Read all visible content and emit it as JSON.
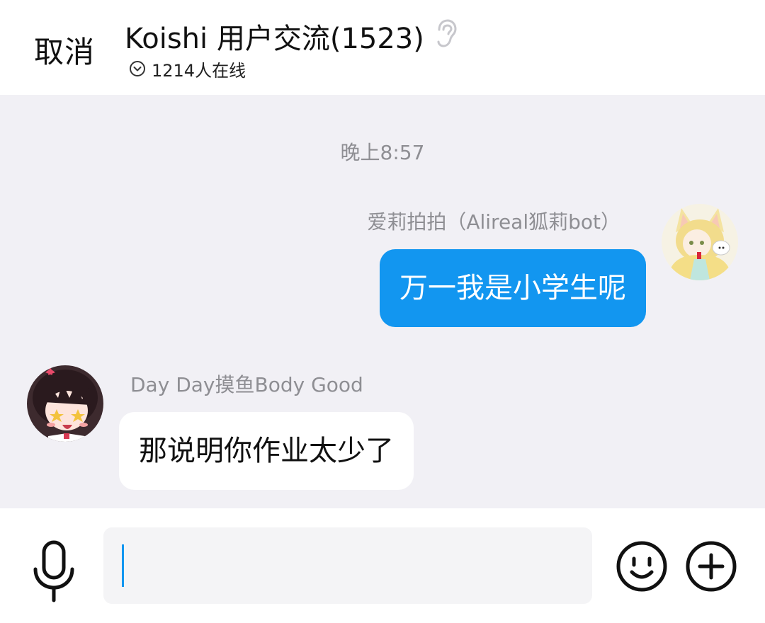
{
  "header": {
    "cancel_label": "取消",
    "group_title": "Koishi 用户交流(1523)",
    "online_count": "1214人在线"
  },
  "chat": {
    "timestamp": "晚上8:57",
    "messages": [
      {
        "side": "right",
        "sender": "爱莉拍拍（Alireal狐莉bot）",
        "text": "万一我是小学生呢",
        "bubble_color": "#1296F0"
      },
      {
        "side": "left",
        "sender": "Day Day摸鱼Body Good",
        "text": "那说明你作业太少了",
        "bubble_color": "#FFFFFF"
      }
    ]
  },
  "input_bar": {
    "icons": [
      "microphone-icon",
      "emoji-icon",
      "plus-icon"
    ],
    "input_value": ""
  },
  "colors": {
    "accent": "#1296F0",
    "chat_background": "#F1F0F5"
  }
}
